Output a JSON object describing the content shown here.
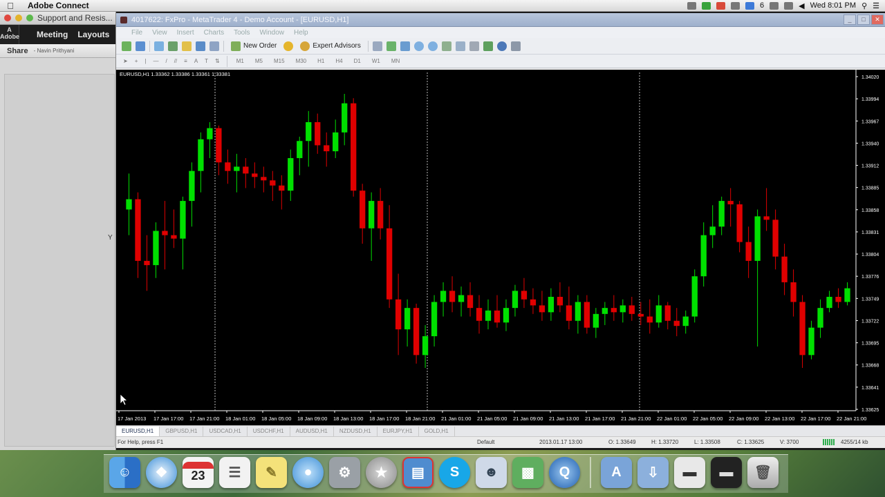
{
  "menubar": {
    "app_name": "Adobe Connect",
    "clock": "Wed 8:01 PM",
    "input_indicator": "6"
  },
  "adobe_connect": {
    "window_title": "Support and Resis...",
    "nav_meeting": "Meeting",
    "nav_layouts": "Layouts",
    "share_label": "Share",
    "share_user": "- Navin Prithyani",
    "marker": "Y"
  },
  "mt4": {
    "window_title": "4017622: FxPro - MetaTrader 4 - Demo Account - [EURUSD,H1]",
    "menu": [
      "File",
      "View",
      "Insert",
      "Charts",
      "Tools",
      "Window",
      "Help"
    ],
    "toolbar": {
      "new_order": "New Order",
      "expert_advisors": "Expert Advisors"
    },
    "timeframes": [
      "M1",
      "M5",
      "M15",
      "M30",
      "H1",
      "H4",
      "D1",
      "W1",
      "MN"
    ],
    "chart_header": "EURUSD,H1  1.33362 1.33386 1.33361 1.33381",
    "symbol_tabs": [
      "EURUSD,H1",
      "GBPUSD,H1",
      "USDCAD,H1",
      "USDCHF,H1",
      "AUDUSD,H1",
      "NZDUSD,H1",
      "EURJPY,H1",
      "GOLD,H1"
    ],
    "status": {
      "help": "For Help, press F1",
      "profile": "Default",
      "datetime": "2013.01.17 13:00",
      "open": "O: 1.33649",
      "high": "H: 1.33720",
      "low": "L: 1.33508",
      "close": "C: 1.33625",
      "volume": "V: 3700",
      "traffic": "4255/14 kb"
    }
  },
  "chart_data": {
    "type": "candlestick",
    "symbol": "EURUSD",
    "timeframe": "H1",
    "up_color": "#00e000",
    "down_color": "#e00000",
    "background": "#000000",
    "ylim": [
      1.33625,
      1.3402
    ],
    "y_ticks": [
      "1.34020",
      "1.33994",
      "1.33967",
      "1.33940",
      "1.33912",
      "1.33885",
      "1.33858",
      "1.33831",
      "1.33804",
      "1.33776",
      "1.33749",
      "1.33722",
      "1.33695",
      "1.33668",
      "1.33641",
      "1.33625"
    ],
    "x_ticks": [
      "17 Jan 2013",
      "17 Jan 17:00",
      "17 Jan 21:00",
      "18 Jan 01:00",
      "18 Jan 05:00",
      "18 Jan 09:00",
      "18 Jan 13:00",
      "18 Jan 17:00",
      "18 Jan 21:00",
      "21 Jan 01:00",
      "21 Jan 05:00",
      "21 Jan 09:00",
      "21 Jan 13:00",
      "21 Jan 17:00",
      "21 Jan 21:00",
      "22 Jan 01:00",
      "22 Jan 05:00",
      "22 Jan 09:00",
      "22 Jan 13:00",
      "22 Jan 17:00",
      "22 Jan 21:00"
    ],
    "candles": [
      {
        "o": 1.3386,
        "h": 1.33902,
        "l": 1.3383,
        "c": 1.33872
      },
      {
        "o": 1.33872,
        "h": 1.3388,
        "l": 1.3378,
        "c": 1.338
      },
      {
        "o": 1.338,
        "h": 1.3383,
        "l": 1.33765,
        "c": 1.33795
      },
      {
        "o": 1.33795,
        "h": 1.33845,
        "l": 1.3378,
        "c": 1.33835
      },
      {
        "o": 1.33835,
        "h": 1.3387,
        "l": 1.3379,
        "c": 1.3383
      },
      {
        "o": 1.3383,
        "h": 1.3386,
        "l": 1.33815,
        "c": 1.33826
      },
      {
        "o": 1.33826,
        "h": 1.33875,
        "l": 1.3379,
        "c": 1.3387
      },
      {
        "o": 1.3387,
        "h": 1.33915,
        "l": 1.3384,
        "c": 1.33905
      },
      {
        "o": 1.33905,
        "h": 1.3395,
        "l": 1.3388,
        "c": 1.33942
      },
      {
        "o": 1.33942,
        "h": 1.33962,
        "l": 1.3392,
        "c": 1.33955
      },
      {
        "o": 1.33955,
        "h": 1.33958,
        "l": 1.339,
        "c": 1.33915
      },
      {
        "o": 1.33915,
        "h": 1.3393,
        "l": 1.3389,
        "c": 1.33905
      },
      {
        "o": 1.33905,
        "h": 1.33925,
        "l": 1.3388,
        "c": 1.3391
      },
      {
        "o": 1.3391,
        "h": 1.3392,
        "l": 1.33885,
        "c": 1.33902
      },
      {
        "o": 1.33902,
        "h": 1.33915,
        "l": 1.33885,
        "c": 1.33898
      },
      {
        "o": 1.33898,
        "h": 1.3391,
        "l": 1.3388,
        "c": 1.33894
      },
      {
        "o": 1.33894,
        "h": 1.33905,
        "l": 1.3387,
        "c": 1.33888
      },
      {
        "o": 1.33888,
        "h": 1.339,
        "l": 1.3386,
        "c": 1.33882
      },
      {
        "o": 1.33882,
        "h": 1.3393,
        "l": 1.3387,
        "c": 1.3392
      },
      {
        "o": 1.3392,
        "h": 1.33945,
        "l": 1.339,
        "c": 1.3394
      },
      {
        "o": 1.3394,
        "h": 1.33975,
        "l": 1.3391,
        "c": 1.33962
      },
      {
        "o": 1.33962,
        "h": 1.33972,
        "l": 1.33925,
        "c": 1.33935
      },
      {
        "o": 1.33935,
        "h": 1.3395,
        "l": 1.3391,
        "c": 1.33928
      },
      {
        "o": 1.33928,
        "h": 1.33965,
        "l": 1.3392,
        "c": 1.3395
      },
      {
        "o": 1.3395,
        "h": 1.33995,
        "l": 1.33935,
        "c": 1.33984
      },
      {
        "o": 1.33984,
        "h": 1.3399,
        "l": 1.33875,
        "c": 1.33882
      },
      {
        "o": 1.33882,
        "h": 1.3389,
        "l": 1.3382,
        "c": 1.33838
      },
      {
        "o": 1.33838,
        "h": 1.3388,
        "l": 1.338,
        "c": 1.3387
      },
      {
        "o": 1.3387,
        "h": 1.33885,
        "l": 1.33825,
        "c": 1.33838
      },
      {
        "o": 1.33838,
        "h": 1.33865,
        "l": 1.33745,
        "c": 1.33755
      },
      {
        "o": 1.33755,
        "h": 1.33785,
        "l": 1.3369,
        "c": 1.3372
      },
      {
        "o": 1.3372,
        "h": 1.33755,
        "l": 1.337,
        "c": 1.33745
      },
      {
        "o": 1.33745,
        "h": 1.3375,
        "l": 1.3368,
        "c": 1.3369
      },
      {
        "o": 1.3369,
        "h": 1.33725,
        "l": 1.33675,
        "c": 1.33712
      },
      {
        "o": 1.33712,
        "h": 1.3376,
        "l": 1.337,
        "c": 1.33752
      },
      {
        "o": 1.33752,
        "h": 1.33775,
        "l": 1.33735,
        "c": 1.33765
      },
      {
        "o": 1.33765,
        "h": 1.33782,
        "l": 1.3374,
        "c": 1.33752
      },
      {
        "o": 1.33752,
        "h": 1.3377,
        "l": 1.33735,
        "c": 1.3376
      },
      {
        "o": 1.3376,
        "h": 1.33775,
        "l": 1.33735,
        "c": 1.33745
      },
      {
        "o": 1.33745,
        "h": 1.3376,
        "l": 1.33715,
        "c": 1.3373
      },
      {
        "o": 1.3373,
        "h": 1.33755,
        "l": 1.3372,
        "c": 1.33742
      },
      {
        "o": 1.33742,
        "h": 1.3376,
        "l": 1.33722,
        "c": 1.33728
      },
      {
        "o": 1.33728,
        "h": 1.33755,
        "l": 1.33718,
        "c": 1.33745
      },
      {
        "o": 1.33745,
        "h": 1.33772,
        "l": 1.33735,
        "c": 1.33765
      },
      {
        "o": 1.33765,
        "h": 1.3378,
        "l": 1.33745,
        "c": 1.33755
      },
      {
        "o": 1.33755,
        "h": 1.33768,
        "l": 1.33738,
        "c": 1.33748
      },
      {
        "o": 1.33748,
        "h": 1.33765,
        "l": 1.3373,
        "c": 1.3374
      },
      {
        "o": 1.3374,
        "h": 1.33768,
        "l": 1.3373,
        "c": 1.33758
      },
      {
        "o": 1.33758,
        "h": 1.33775,
        "l": 1.3374,
        "c": 1.33748
      },
      {
        "o": 1.33748,
        "h": 1.3377,
        "l": 1.3372,
        "c": 1.3373
      },
      {
        "o": 1.3373,
        "h": 1.3376,
        "l": 1.33715,
        "c": 1.33752
      },
      {
        "o": 1.33752,
        "h": 1.3376,
        "l": 1.33715,
        "c": 1.33722
      },
      {
        "o": 1.33722,
        "h": 1.33745,
        "l": 1.3371,
        "c": 1.33738
      },
      {
        "o": 1.33738,
        "h": 1.33752,
        "l": 1.33725,
        "c": 1.33745
      },
      {
        "o": 1.33745,
        "h": 1.3376,
        "l": 1.3373,
        "c": 1.3374
      },
      {
        "o": 1.3374,
        "h": 1.33755,
        "l": 1.33728,
        "c": 1.33748
      },
      {
        "o": 1.33748,
        "h": 1.33758,
        "l": 1.3373,
        "c": 1.33738
      },
      {
        "o": 1.33738,
        "h": 1.33752,
        "l": 1.33725,
        "c": 1.33735
      },
      {
        "o": 1.33735,
        "h": 1.33755,
        "l": 1.33715,
        "c": 1.33728
      },
      {
        "o": 1.33728,
        "h": 1.3376,
        "l": 1.33722,
        "c": 1.33748
      },
      {
        "o": 1.33748,
        "h": 1.33752,
        "l": 1.3372,
        "c": 1.3373
      },
      {
        "o": 1.3373,
        "h": 1.33745,
        "l": 1.33712,
        "c": 1.33724
      },
      {
        "o": 1.33724,
        "h": 1.33742,
        "l": 1.33715,
        "c": 1.33735
      },
      {
        "o": 1.33735,
        "h": 1.3379,
        "l": 1.33728,
        "c": 1.33782
      },
      {
        "o": 1.33782,
        "h": 1.33845,
        "l": 1.3377,
        "c": 1.3383
      },
      {
        "o": 1.3383,
        "h": 1.33865,
        "l": 1.33815,
        "c": 1.3384
      },
      {
        "o": 1.3384,
        "h": 1.33875,
        "l": 1.3383,
        "c": 1.3387
      },
      {
        "o": 1.3387,
        "h": 1.33885,
        "l": 1.3384,
        "c": 1.33866
      },
      {
        "o": 1.33866,
        "h": 1.3387,
        "l": 1.3381,
        "c": 1.33822
      },
      {
        "o": 1.33822,
        "h": 1.3384,
        "l": 1.3378,
        "c": 1.338
      },
      {
        "o": 1.338,
        "h": 1.3386,
        "l": 1.337,
        "c": 1.33852
      },
      {
        "o": 1.33852,
        "h": 1.33885,
        "l": 1.33835,
        "c": 1.33848
      },
      {
        "o": 1.33848,
        "h": 1.3386,
        "l": 1.3379,
        "c": 1.33805
      },
      {
        "o": 1.33805,
        "h": 1.3382,
        "l": 1.3376,
        "c": 1.33775
      },
      {
        "o": 1.33775,
        "h": 1.3379,
        "l": 1.33735,
        "c": 1.33752
      },
      {
        "o": 1.33752,
        "h": 1.3376,
        "l": 1.33675,
        "c": 1.3369
      },
      {
        "o": 1.3369,
        "h": 1.3373,
        "l": 1.33685,
        "c": 1.33722
      },
      {
        "o": 1.33722,
        "h": 1.33755,
        "l": 1.3371,
        "c": 1.33745
      },
      {
        "o": 1.33745,
        "h": 1.33765,
        "l": 1.3374,
        "c": 1.33758
      },
      {
        "o": 1.33758,
        "h": 1.33768,
        "l": 1.33745,
        "c": 1.33752
      },
      {
        "o": 1.33752,
        "h": 1.33775,
        "l": 1.33748,
        "c": 1.33768
      }
    ]
  },
  "dock": {
    "calendar_day": "23",
    "apps": [
      "Finder",
      "Safari",
      "Calendar",
      "Notes",
      "Stickies",
      "Messages",
      "System Preferences",
      "Launchpad",
      "MetaTrader",
      "Skype",
      "Contacts",
      "Numbers",
      "QuickTime",
      "Applications",
      "Downloads",
      "Window",
      "Terminal",
      "Trash"
    ]
  }
}
